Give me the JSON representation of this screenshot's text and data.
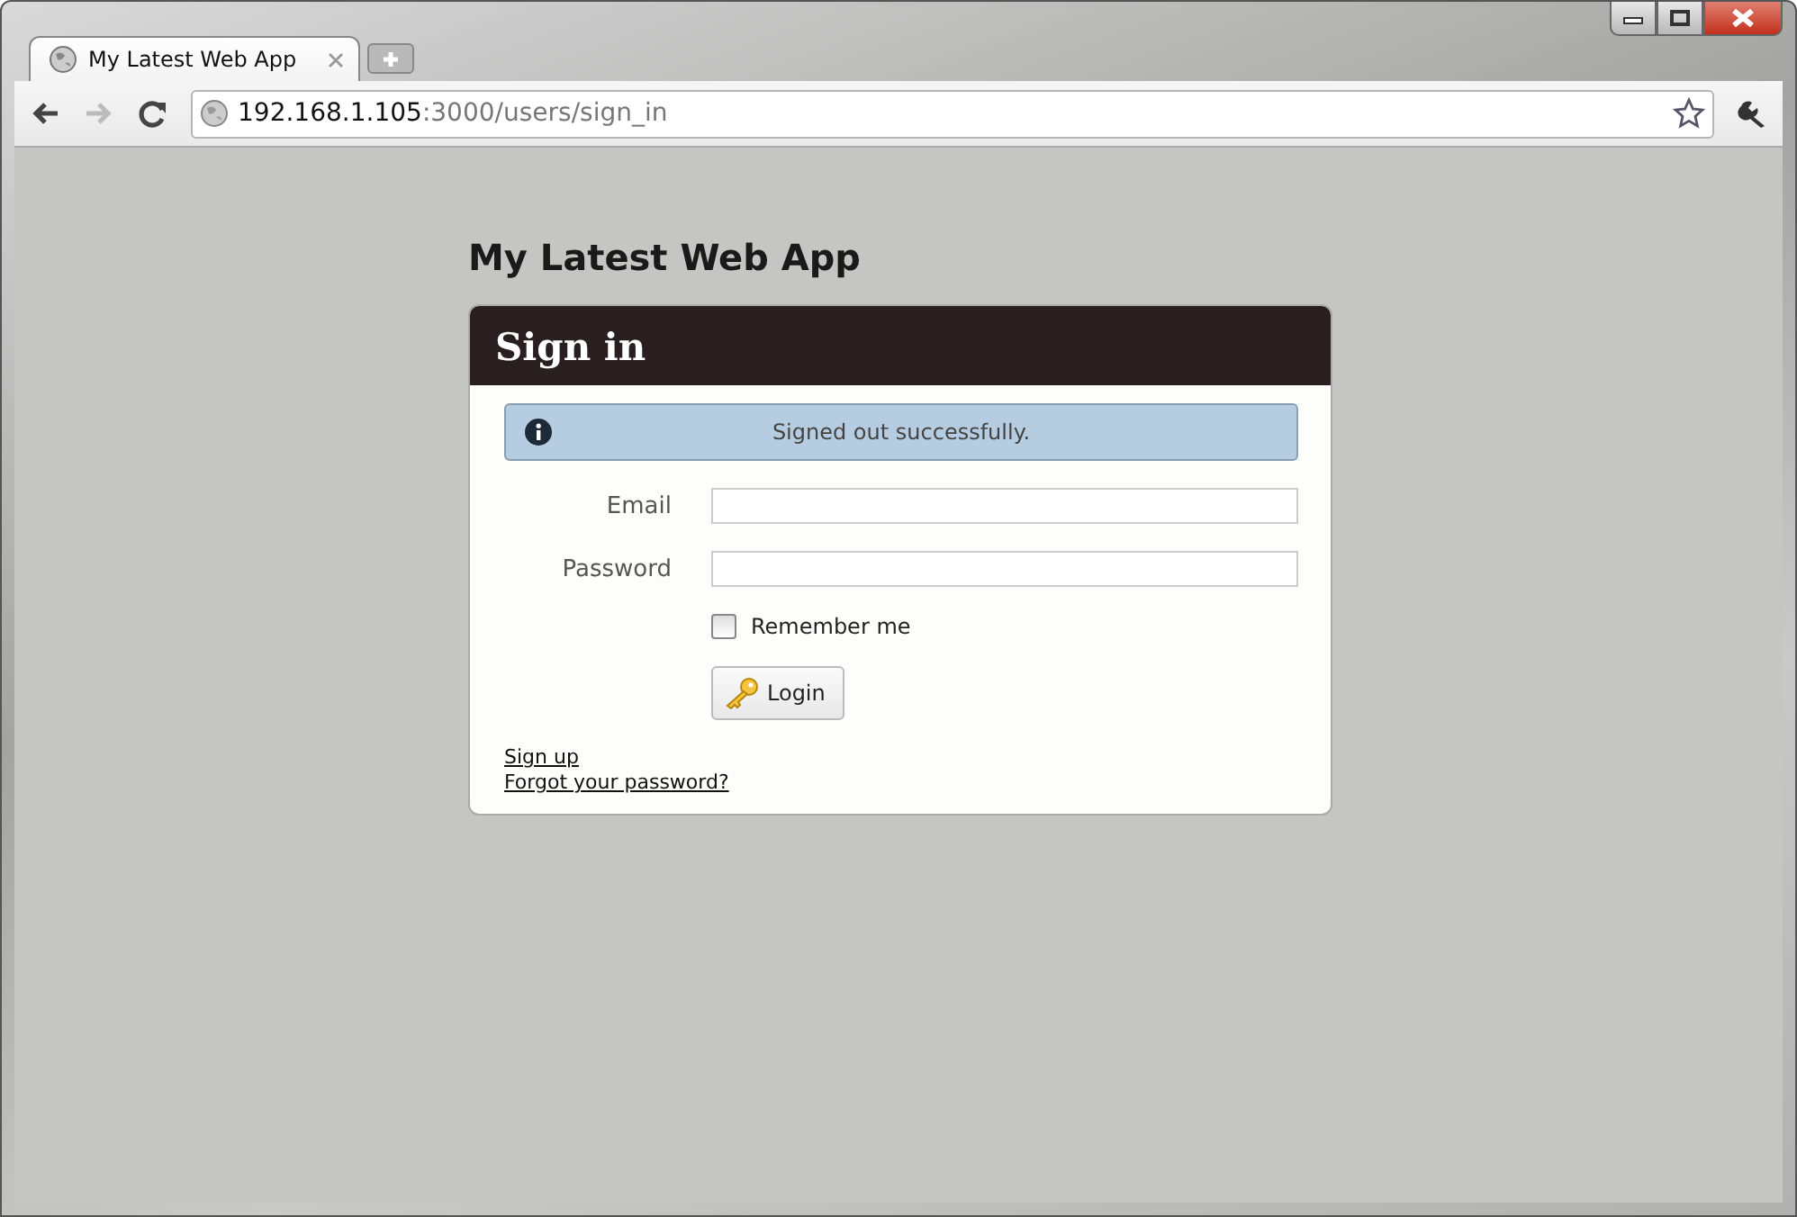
{
  "tabs": [
    {
      "label": "My Latest Web App",
      "selected": true
    }
  ],
  "address_bar": {
    "host": "192.168.1.105",
    "path": ":3000/users/sign_in"
  },
  "page": {
    "heading": "My Latest Web App",
    "card": {
      "title": "Sign in",
      "alert": {
        "message": "Signed out successfully."
      },
      "fields": [
        {
          "label": "Email"
        },
        {
          "label": "Password"
        }
      ],
      "remember": {
        "label": "Remember me",
        "checked": false
      },
      "submit": {
        "label": "Login"
      },
      "links": [
        "Sign up",
        "Forgot your password?"
      ]
    }
  }
}
